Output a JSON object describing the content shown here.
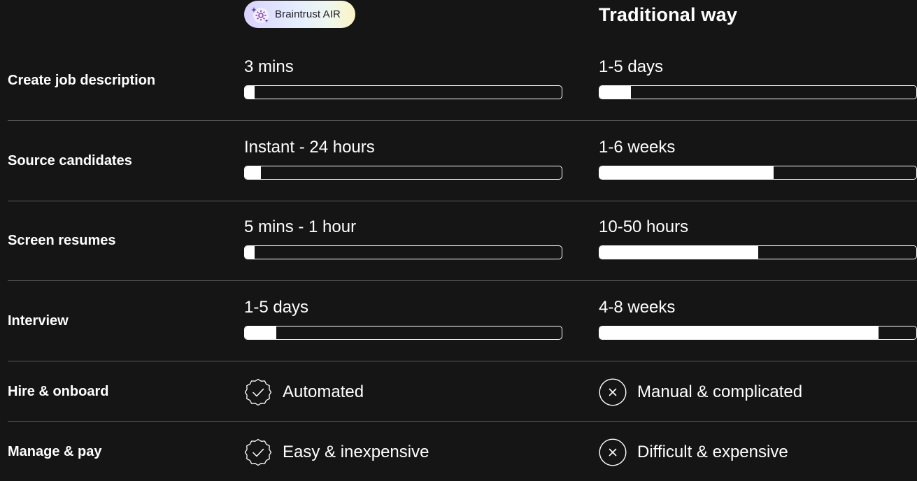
{
  "header": {
    "air_badge_label": "Braintrust AIR",
    "air_badge_icon": "sparkle-gear-icon",
    "traditional_title": "Traditional way"
  },
  "rows": [
    {
      "label": "Create job description",
      "air": {
        "text": "3 mins",
        "progress": 0.03
      },
      "traditional": {
        "text": "1-5 days",
        "progress": 0.1
      }
    },
    {
      "label": "Source candidates",
      "air": {
        "text": "Instant - 24 hours",
        "progress": 0.05
      },
      "traditional": {
        "text": "1-6 weeks",
        "progress": 0.55
      }
    },
    {
      "label": "Screen resumes",
      "air": {
        "text": "5 mins - 1 hour",
        "progress": 0.03
      },
      "traditional": {
        "text": "10-50 hours",
        "progress": 0.5
      }
    },
    {
      "label": "Interview",
      "air": {
        "text": "1-5 days",
        "progress": 0.1
      },
      "traditional": {
        "text": "4-8 weeks",
        "progress": 0.88
      }
    },
    {
      "label": "Hire & onboard",
      "air": {
        "text": "Automated",
        "icon": "badge-check-icon"
      },
      "traditional": {
        "text": "Manual & complicated",
        "icon": "x-circle-icon"
      }
    },
    {
      "label": "Manage & pay",
      "air": {
        "text": "Easy & inexpensive",
        "icon": "badge-check-icon"
      },
      "traditional": {
        "text": "Difficult & expensive",
        "icon": "x-circle-icon"
      }
    }
  ],
  "colors": {
    "background": "#161516",
    "text": "#ffffff",
    "divider": "#5a5a5a"
  }
}
